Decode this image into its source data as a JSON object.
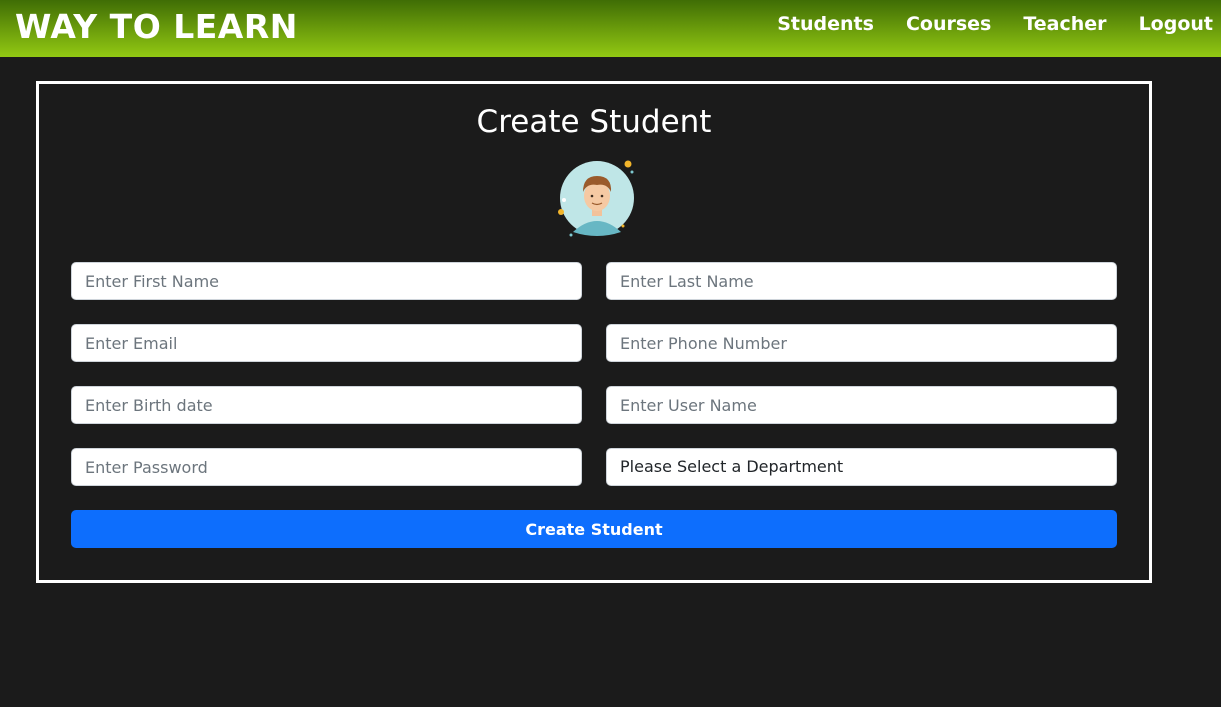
{
  "navbar": {
    "brand": "WAY TO LEARN",
    "links": [
      "Students",
      "Courses",
      "Teacher",
      "Logout"
    ],
    "colors": {
      "gradient_top": "#3f6d05",
      "gradient_bottom": "#92c913"
    }
  },
  "form": {
    "title": "Create Student",
    "avatar_icon": "student-avatar-icon",
    "fields": {
      "first_name": {
        "placeholder": "Enter First Name",
        "value": ""
      },
      "last_name": {
        "placeholder": "Enter Last Name",
        "value": ""
      },
      "email": {
        "placeholder": "Enter Email",
        "value": ""
      },
      "phone": {
        "placeholder": "Enter Phone Number",
        "value": ""
      },
      "birth_date": {
        "placeholder": "Enter Birth date",
        "value": ""
      },
      "user_name": {
        "placeholder": "Enter User Name",
        "value": ""
      },
      "password": {
        "placeholder": "Enter Password",
        "value": ""
      },
      "department": {
        "selected": "Please Select a Department"
      }
    },
    "submit_label": "Create Student",
    "colors": {
      "submit": "#0d6efd",
      "background": "#1b1b1b",
      "border": "#ffffff"
    }
  }
}
